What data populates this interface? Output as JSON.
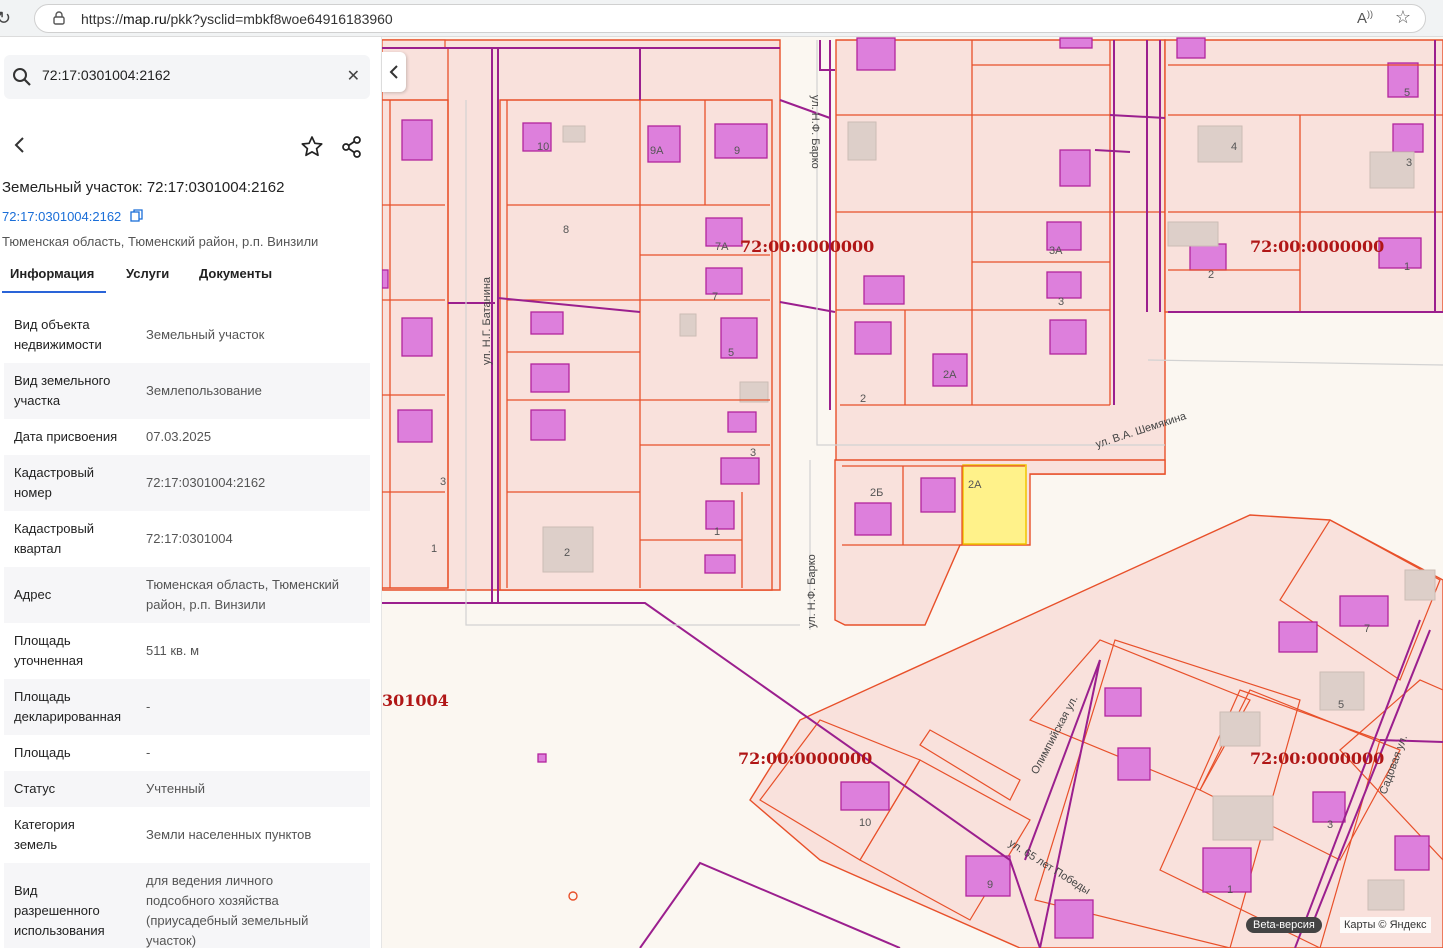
{
  "browser": {
    "url_prefix": "https://",
    "url_host": "map.ru",
    "url_path": "/pkk?ysclid=mbkf8woe64916183960"
  },
  "search": {
    "value": "72:17:0301004:2162"
  },
  "object": {
    "title": "Земельный участок: 72:17:0301004:2162",
    "link": "72:17:0301004:2162",
    "address_short": "Тюменская область, Тюменский район, р.п. Винзили"
  },
  "tabs": [
    {
      "label": "Информация"
    },
    {
      "label": "Услуги"
    },
    {
      "label": "Документы"
    }
  ],
  "properties": [
    {
      "key_lines": [
        "Вид объекта",
        "недвижимости"
      ],
      "value_lines": [
        "Земельный участок"
      ]
    },
    {
      "key_lines": [
        "Вид земельного",
        "участка"
      ],
      "value_lines": [
        "Землепользование"
      ]
    },
    {
      "key_lines": [
        "Дата присвоения"
      ],
      "value_lines": [
        "07.03.2025"
      ]
    },
    {
      "key_lines": [
        "Кадастровый",
        "номер"
      ],
      "value_lines": [
        "72:17:0301004:2162"
      ]
    },
    {
      "key_lines": [
        "Кадастровый",
        "квартал"
      ],
      "value_lines": [
        "72:17:0301004"
      ]
    },
    {
      "key_lines": [
        "Адрес"
      ],
      "value_lines": [
        "Тюменская область, Тюменский",
        "район, р.п. Винзили"
      ]
    },
    {
      "key_lines": [
        "Площадь",
        "уточненная"
      ],
      "value_lines": [
        "511 кв. м"
      ]
    },
    {
      "key_lines": [
        "Площадь",
        "декларированная"
      ],
      "value_lines": [
        "-"
      ]
    },
    {
      "key_lines": [
        "Площадь"
      ],
      "value_lines": [
        "-"
      ]
    },
    {
      "key_lines": [
        "Статус"
      ],
      "value_lines": [
        "Учтенный"
      ]
    },
    {
      "key_lines": [
        "Категория",
        "земель"
      ],
      "value_lines": [
        "Земли населенных пунктов"
      ]
    },
    {
      "key_lines": [
        "Вид",
        "разрешенного",
        "использования"
      ],
      "value_lines": [
        "для ведения личного",
        "подсобного хозяйства",
        "(приусадебный земельный",
        "участок)"
      ]
    }
  ],
  "map": {
    "quarter_labels": [
      "72:00:0000000",
      "72:00:0000000",
      "72:00:0000000",
      "72:00:0000000",
      "301004"
    ],
    "street_labels": [
      "ул. Н.Г. Батанина",
      "ул. Н.Ф. Барко",
      "ул. Н.Ф. Барко",
      "ул. В.А. Шемякина",
      "Олимпийская ул.",
      "ул. 65 лет Победы",
      "Садовая ул."
    ],
    "parcel_numbers": [
      "10",
      "9А",
      "9",
      "8",
      "7А",
      "7",
      "5",
      "3",
      "1",
      "2",
      "3",
      "1",
      "3А",
      "3",
      "2А",
      "2",
      "2Б",
      "2А",
      "4",
      "3",
      "5",
      "2",
      "1",
      "7",
      "5",
      "1",
      "10",
      "9",
      "3"
    ],
    "beta_label": "Beta-версия",
    "copyright": "Карты © Яндекс",
    "colors": {
      "parcel_fill": "#f9e1dc",
      "parcel_line": "#e8502a",
      "building": "#dd7fdc",
      "building_line": "#b2259d",
      "quarter_line": "#9b1f8e",
      "highlight": "#fff28a",
      "quarter_text": "#b01616"
    }
  }
}
